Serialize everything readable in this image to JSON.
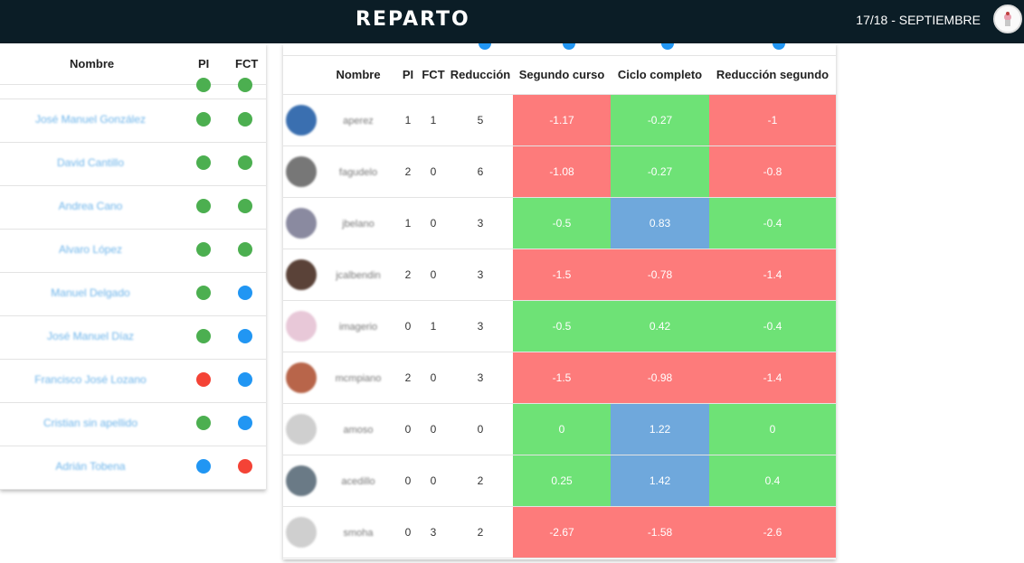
{
  "header": {
    "brand": "REPARTO",
    "period": "17/18 - SEPTIEMBRE"
  },
  "left_table": {
    "headers": {
      "name": "Nombre",
      "pi": "PI",
      "fct": "FCT"
    },
    "rows": [
      {
        "name": "José Manuel González",
        "pi": "green",
        "fct": "green"
      },
      {
        "name": "David Cantillo",
        "pi": "green",
        "fct": "green"
      },
      {
        "name": "Andrea Cano",
        "pi": "green",
        "fct": "green"
      },
      {
        "name": "Alvaro López",
        "pi": "green",
        "fct": "green"
      },
      {
        "name": "Manuel Delgado",
        "pi": "green",
        "fct": "blue"
      },
      {
        "name": "José Manuel Díaz",
        "pi": "green",
        "fct": "blue"
      },
      {
        "name": "Francisco José Lozano",
        "pi": "red",
        "fct": "blue"
      },
      {
        "name": "Cristian sin apellido",
        "pi": "green",
        "fct": "blue"
      },
      {
        "name": "Adrián Tobena",
        "pi": "blue",
        "fct": "red"
      }
    ]
  },
  "right_table": {
    "headers": {
      "name": "Nombre",
      "pi": "PI",
      "fct": "FCT",
      "reduction": "Reducción",
      "second": "Segundo curso",
      "full": "Ciclo completo",
      "second_red": "Reducción segundo"
    },
    "rows": [
      {
        "user": "aperez",
        "avatar": "#3a6fb0",
        "pi": "1",
        "fct": "1",
        "reduction": "5",
        "second": "-1.17",
        "second_c": "red",
        "full": "-0.27",
        "full_c": "green",
        "second_red": "-1",
        "second_red_c": "red"
      },
      {
        "user": "fagudelo",
        "avatar": "#777777",
        "pi": "2",
        "fct": "0",
        "reduction": "6",
        "second": "-1.08",
        "second_c": "red",
        "full": "-0.27",
        "full_c": "green",
        "second_red": "-0.8",
        "second_red_c": "red"
      },
      {
        "user": "jbelano",
        "avatar": "#8a8aa0",
        "pi": "1",
        "fct": "0",
        "reduction": "3",
        "second": "-0.5",
        "second_c": "green",
        "full": "0.83",
        "full_c": "blue",
        "second_red": "-0.4",
        "second_red_c": "green"
      },
      {
        "user": "jcalbendin",
        "avatar": "#5a4238",
        "pi": "2",
        "fct": "0",
        "reduction": "3",
        "second": "-1.5",
        "second_c": "red",
        "full": "-0.78",
        "full_c": "red",
        "second_red": "-1.4",
        "second_red_c": "red"
      },
      {
        "user": "imagerio",
        "avatar": "#e8c8d8",
        "pi": "0",
        "fct": "1",
        "reduction": "3",
        "second": "-0.5",
        "second_c": "green",
        "full": "0.42",
        "full_c": "green",
        "second_red": "-0.4",
        "second_red_c": "green"
      },
      {
        "user": "mcmpiano",
        "avatar": "#b8654a",
        "pi": "2",
        "fct": "0",
        "reduction": "3",
        "second": "-1.5",
        "second_c": "red",
        "full": "-0.98",
        "full_c": "red",
        "second_red": "-1.4",
        "second_red_c": "red"
      },
      {
        "user": "amoso",
        "avatar": "#cfcfcf",
        "pi": "0",
        "fct": "0",
        "reduction": "0",
        "second": "0",
        "second_c": "green",
        "full": "1.22",
        "full_c": "blue",
        "second_red": "0",
        "second_red_c": "green"
      },
      {
        "user": "acedillo",
        "avatar": "#6a7a86",
        "pi": "0",
        "fct": "0",
        "reduction": "2",
        "second": "0.25",
        "second_c": "green",
        "full": "1.42",
        "full_c": "blue",
        "second_red": "0.4",
        "second_red_c": "green"
      },
      {
        "user": "smoha",
        "avatar": "#cfcfcf",
        "pi": "0",
        "fct": "3",
        "reduction": "2",
        "second": "-2.67",
        "second_c": "red",
        "full": "-1.58",
        "full_c": "red",
        "second_red": "-2.6",
        "second_red_c": "red"
      }
    ]
  }
}
